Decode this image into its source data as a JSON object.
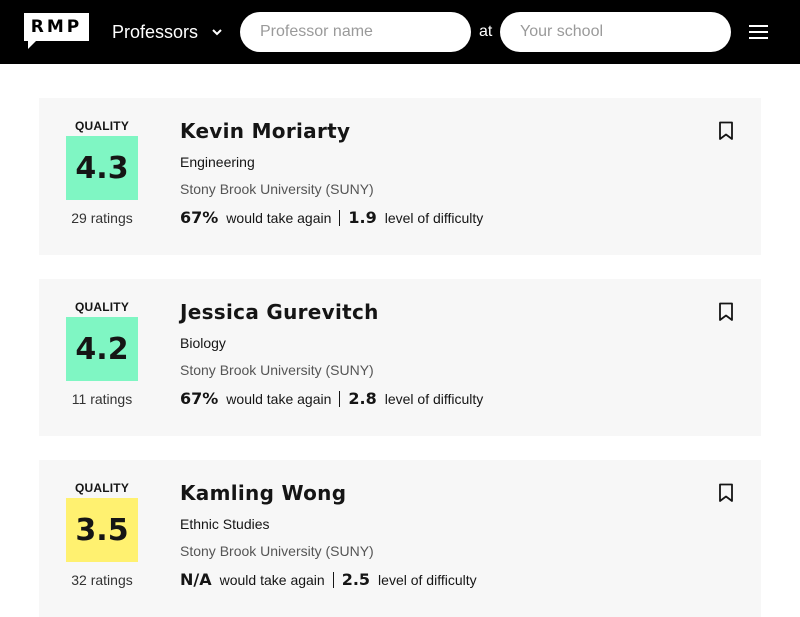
{
  "header": {
    "logo_text": "RMP",
    "search_type": "Professors",
    "name_placeholder": "Professor name",
    "at_label": "at",
    "school_placeholder": "Your school"
  },
  "colors": {
    "high_quality": "#7ff6c3",
    "mid_quality": "#fff170"
  },
  "professors": [
    {
      "quality_label": "QUALITY",
      "rating": "4.3",
      "ratings_count": "29 ratings",
      "name": "Kevin Moriarty",
      "department": "Engineering",
      "school": "Stony Brook University (SUNY)",
      "take_again": "67%",
      "take_again_label": "would take again",
      "difficulty": "1.9",
      "difficulty_label": "level of difficulty",
      "quality_color": "#7ff6c3"
    },
    {
      "quality_label": "QUALITY",
      "rating": "4.2",
      "ratings_count": "11 ratings",
      "name": "Jessica Gurevitch",
      "department": "Biology",
      "school": "Stony Brook University (SUNY)",
      "take_again": "67%",
      "take_again_label": "would take again",
      "difficulty": "2.8",
      "difficulty_label": "level of difficulty",
      "quality_color": "#7ff6c3"
    },
    {
      "quality_label": "QUALITY",
      "rating": "3.5",
      "ratings_count": "32 ratings",
      "name": "Kamling Wong",
      "department": "Ethnic Studies",
      "school": "Stony Brook University (SUNY)",
      "take_again": "N/A",
      "take_again_label": "would take again",
      "difficulty": "2.5",
      "difficulty_label": "level of difficulty",
      "quality_color": "#fff170"
    }
  ]
}
